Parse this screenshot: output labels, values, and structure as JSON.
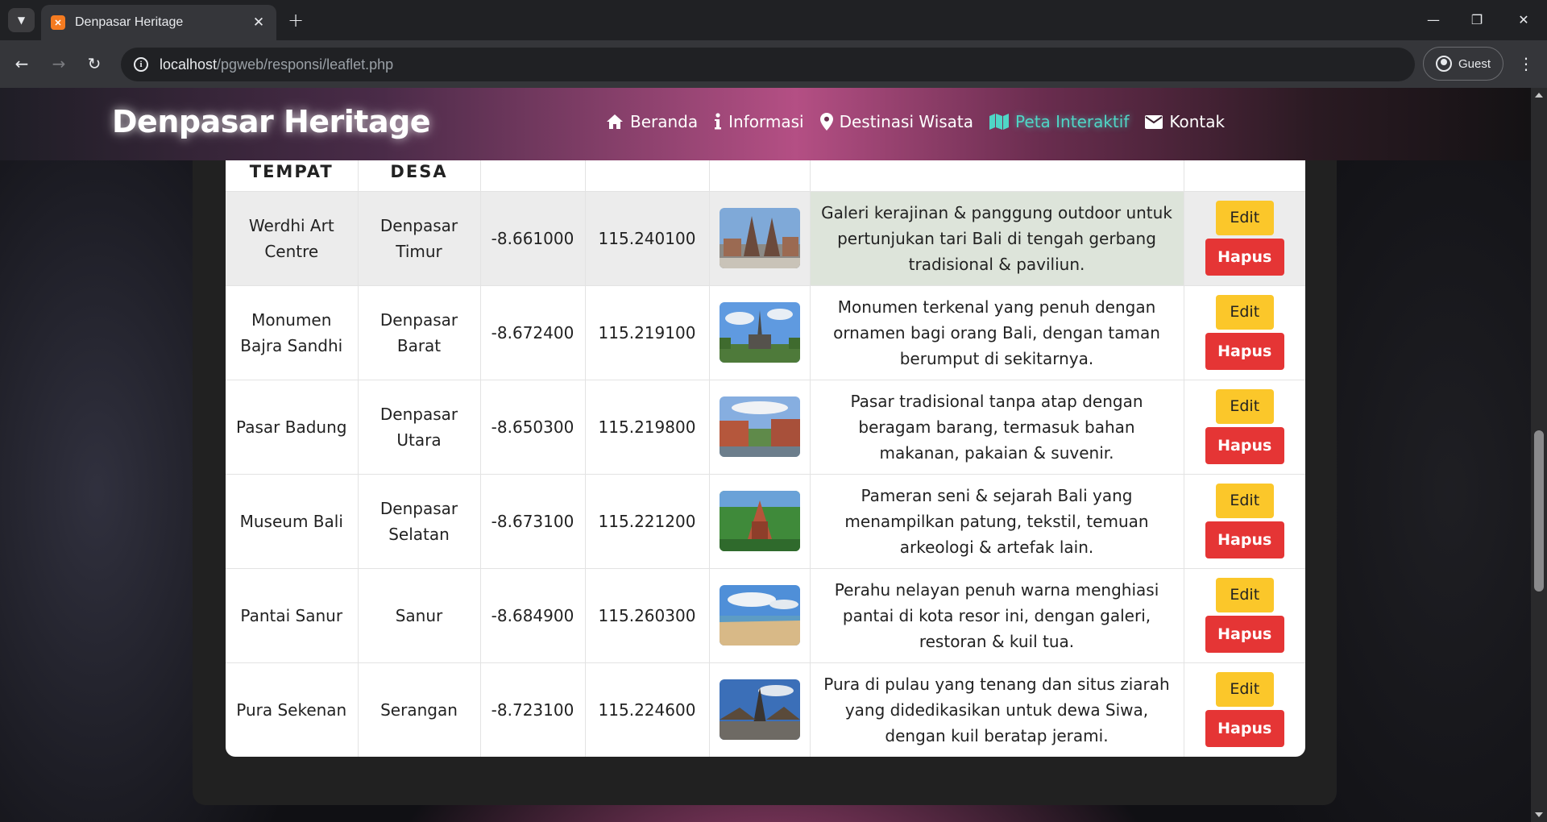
{
  "browser": {
    "tab_title": "Denpasar Heritage",
    "url_host": "localhost",
    "url_path": "/pgweb/responsi/leaflet.php",
    "profile_label": "Guest"
  },
  "site": {
    "brand": "Denpasar Heritage",
    "nav": [
      {
        "label": "Beranda",
        "icon": "home-icon"
      },
      {
        "label": "Informasi",
        "icon": "info-icon"
      },
      {
        "label": "Destinasi Wisata",
        "icon": "map-pin-icon"
      },
      {
        "label": "Peta Interaktif",
        "icon": "map-icon",
        "active": true
      },
      {
        "label": "Kontak",
        "icon": "envelope-icon"
      }
    ],
    "active_color": "#4fd6c6"
  },
  "table": {
    "headers": [
      "TEMPAT",
      "DESA",
      "",
      "",
      "",
      "",
      ""
    ],
    "edit_label": "Edit",
    "delete_label": "Hapus",
    "rows": [
      {
        "tempat": "Werdhi Art Centre",
        "desa": "Denpasar Timur",
        "lat": "-8.661000",
        "lng": "115.240100",
        "photo": "temple-gate-photo",
        "desc": "Galeri kerajinan & panggung outdoor untuk pertunjukan tari Bali di tengah gerbang tradisional & paviliun."
      },
      {
        "tempat": "Monumen Bajra Sandhi",
        "desa": "Denpasar Barat",
        "lat": "-8.672400",
        "lng": "115.219100",
        "photo": "monument-photo",
        "desc": "Monumen terkenal yang penuh dengan ornamen bagi orang Bali, dengan taman berumput di sekitarnya."
      },
      {
        "tempat": "Pasar Badung",
        "desa": "Denpasar Utara",
        "lat": "-8.650300",
        "lng": "115.219800",
        "photo": "market-photo",
        "desc": "Pasar tradisional tanpa atap dengan beragam barang, termasuk bahan makanan, pakaian & suvenir."
      },
      {
        "tempat": "Museum Bali",
        "desa": "Denpasar Selatan",
        "lat": "-8.673100",
        "lng": "115.221200",
        "photo": "museum-photo",
        "desc": "Pameran seni & sejarah Bali yang menampilkan patung, tekstil, temuan arkeologi & artefak lain."
      },
      {
        "tempat": "Pantai Sanur",
        "desa": "Sanur",
        "lat": "-8.684900",
        "lng": "115.260300",
        "photo": "beach-photo",
        "desc": "Perahu nelayan penuh warna menghiasi pantai di kota resor ini, dengan galeri, restoran & kuil tua."
      },
      {
        "tempat": "Pura Sekenan",
        "desa": "Serangan",
        "lat": "-8.723100",
        "lng": "115.224600",
        "photo": "temple-photo",
        "desc": "Pura di pulau yang tenang dan situs ziarah yang didedikasikan untuk dewa Siwa, dengan kuil beratap jerami."
      }
    ]
  }
}
